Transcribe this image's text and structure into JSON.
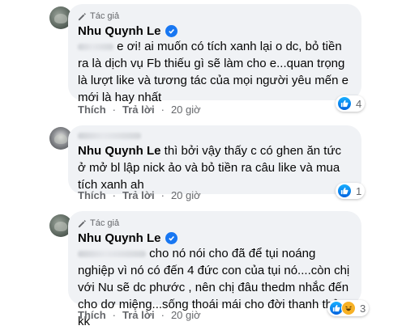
{
  "comments": [
    {
      "badge": "Tác giả",
      "author": "Nhu Quynh Le",
      "text": "e ơi! ai muốn có tích xanh lại o dc, bỏ tiền ra là dịch vụ Fb thiếu gì sẽ làm cho e...quan trọng là lượt like và tương tác của mọi người yêu mến e mới là hay nhất",
      "like_label": "Thích",
      "reply_label": "Trả lời",
      "time": "20 giờ",
      "reaction_count": "4"
    },
    {
      "mention": "Nhu Quynh Le",
      "text": "thì bởi vậy thấy c có ghen ăn tức ở mở bl lập nick ảo và bỏ tiền ra câu like và mua tích xanh ah",
      "like_label": "Thích",
      "reply_label": "Trả lời",
      "time": "20 giờ",
      "reaction_count": "1"
    },
    {
      "badge": "Tác giả",
      "author": "Nhu Quynh Le",
      "text": "cho nó nói cho đã để tụi noáng nghiệp vì nó có đến 4 đức con của tụi nó....còn chị với Nu sẽ dc phước , nên chị đâu thedm nhắc đến cho dơ miệng...sống thoái mái cho đời thanh thản kk",
      "like_label": "Thích",
      "reply_label": "Trả lời",
      "time": "20 giờ",
      "reaction_count": "3"
    }
  ],
  "colors": {
    "verified": "#1877f2",
    "bubble": "#f0f2f5",
    "meta": "#65676b"
  },
  "icons": [
    "pencil-icon",
    "verified-badge-icon",
    "like-reaction-icon",
    "haha-reaction-icon"
  ]
}
